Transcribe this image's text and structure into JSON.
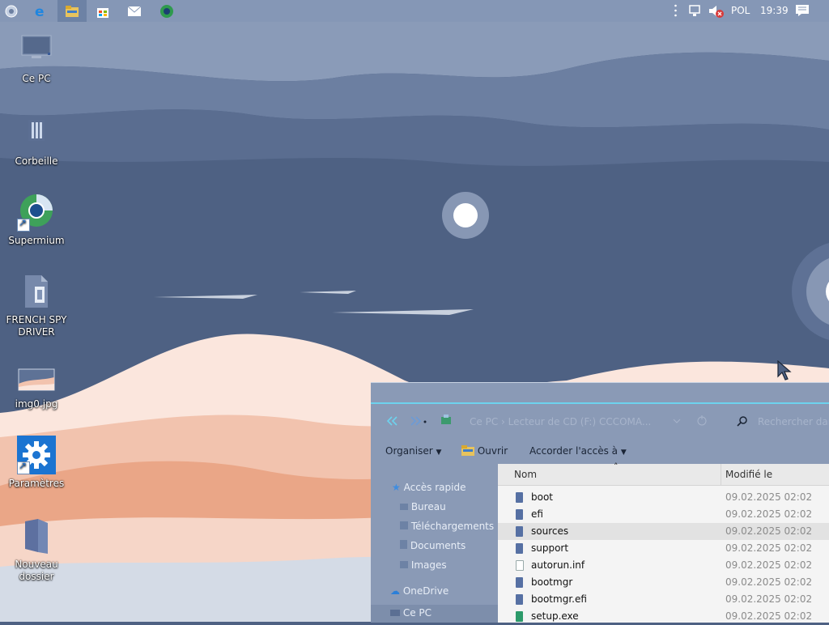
{
  "taskbar": {
    "apps": [
      {
        "icon": "start-orb-icon"
      },
      {
        "icon": "edge-icon"
      },
      {
        "icon": "file-explorer-icon",
        "active": true
      },
      {
        "icon": "store-icon"
      },
      {
        "icon": "mail-icon"
      },
      {
        "icon": "supermium-icon"
      }
    ],
    "language": "POL",
    "time": "19:39"
  },
  "desktop": {
    "icons": [
      {
        "label": "Ce PC",
        "icon": "computer-icon"
      },
      {
        "label": "Corbeille",
        "icon": "recycle-bin-icon"
      },
      {
        "label": "Supermium",
        "icon": "supermium-browser-icon"
      },
      {
        "label": "FRENCH SPY DRIVER",
        "icon": "drive-file-icon"
      },
      {
        "label": "img0.jpg",
        "icon": "image-file-icon"
      },
      {
        "label": "Paramètres",
        "icon": "settings-icon"
      },
      {
        "label": "Nouveau dossier",
        "icon": "folder-icon"
      }
    ]
  },
  "explorer": {
    "address": "Ce PC  ›  Lecteur de CD (F:) CCCOMA...",
    "search_placeholder": "Rechercher dans...",
    "ribbon": {
      "organize": "Organiser",
      "open": "Ouvrir",
      "share": "Accorder l'accès à"
    },
    "nav": [
      {
        "label": "Accès rapide",
        "sub": false
      },
      {
        "label": "Bureau",
        "sub": true
      },
      {
        "label": "Téléchargements",
        "sub": true
      },
      {
        "label": "Documents",
        "sub": true
      },
      {
        "label": "Images",
        "sub": true
      },
      {
        "label": "OneDrive",
        "sub": false
      },
      {
        "label": "Ce PC",
        "sub": false
      }
    ],
    "columns": {
      "name": "Nom",
      "modified": "Modifié le"
    },
    "files": [
      {
        "name": "boot",
        "date": "09.02.2025 02:02",
        "type": "folder"
      },
      {
        "name": "efi",
        "date": "09.02.2025 02:02",
        "type": "folder"
      },
      {
        "name": "sources",
        "date": "09.02.2025 02:02",
        "type": "folder",
        "selected": true
      },
      {
        "name": "support",
        "date": "09.02.2025 02:02",
        "type": "folder"
      },
      {
        "name": "autorun.inf",
        "date": "09.02.2025 02:02",
        "type": "doc"
      },
      {
        "name": "bootmgr",
        "date": "09.02.2025 02:02",
        "type": "file"
      },
      {
        "name": "bootmgr.efi",
        "date": "09.02.2025 02:02",
        "type": "file"
      },
      {
        "name": "setup.exe",
        "date": "09.02.2025 02:02",
        "type": "exe"
      }
    ]
  },
  "colors": {
    "taskbar": "#8597b6",
    "wallpaper_sky": "#4e6183",
    "accent": "#6dd3ee"
  }
}
